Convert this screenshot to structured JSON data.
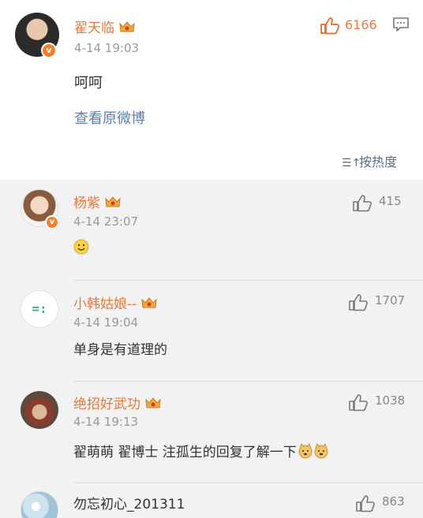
{
  "main_post": {
    "username": "翟天临",
    "time": "4-14 19:03",
    "text": "呵呵",
    "view_original": "查看原微博",
    "likes": "6166",
    "verified_mark": "v"
  },
  "sort_label": "按热度",
  "comments": [
    {
      "username": "杨紫",
      "time": "4-14 23:07",
      "text": "",
      "likes": "415",
      "verified_mark": "v"
    },
    {
      "username": "小韩姑娘--",
      "time": "4-14 19:04",
      "text": "单身是有道理的",
      "likes": "1707",
      "avatar_text": "=:"
    },
    {
      "username": "绝招好武功",
      "time": "4-14 19:13",
      "text": "翟萌萌 翟博士 注孤生的回复了解一下",
      "likes": "1038"
    },
    {
      "username": "勿忘初心_201311",
      "likes": "863"
    }
  ],
  "colors": {
    "username": "#e8793a",
    "link": "#5a7fb0",
    "time": "#999999",
    "like_accent": "#e8793a"
  },
  "icons": [
    "crown-badge-icon",
    "thumbs-up-icon",
    "comment-icon",
    "sort-icon",
    "smile-emoji",
    "doge-emoji"
  ]
}
